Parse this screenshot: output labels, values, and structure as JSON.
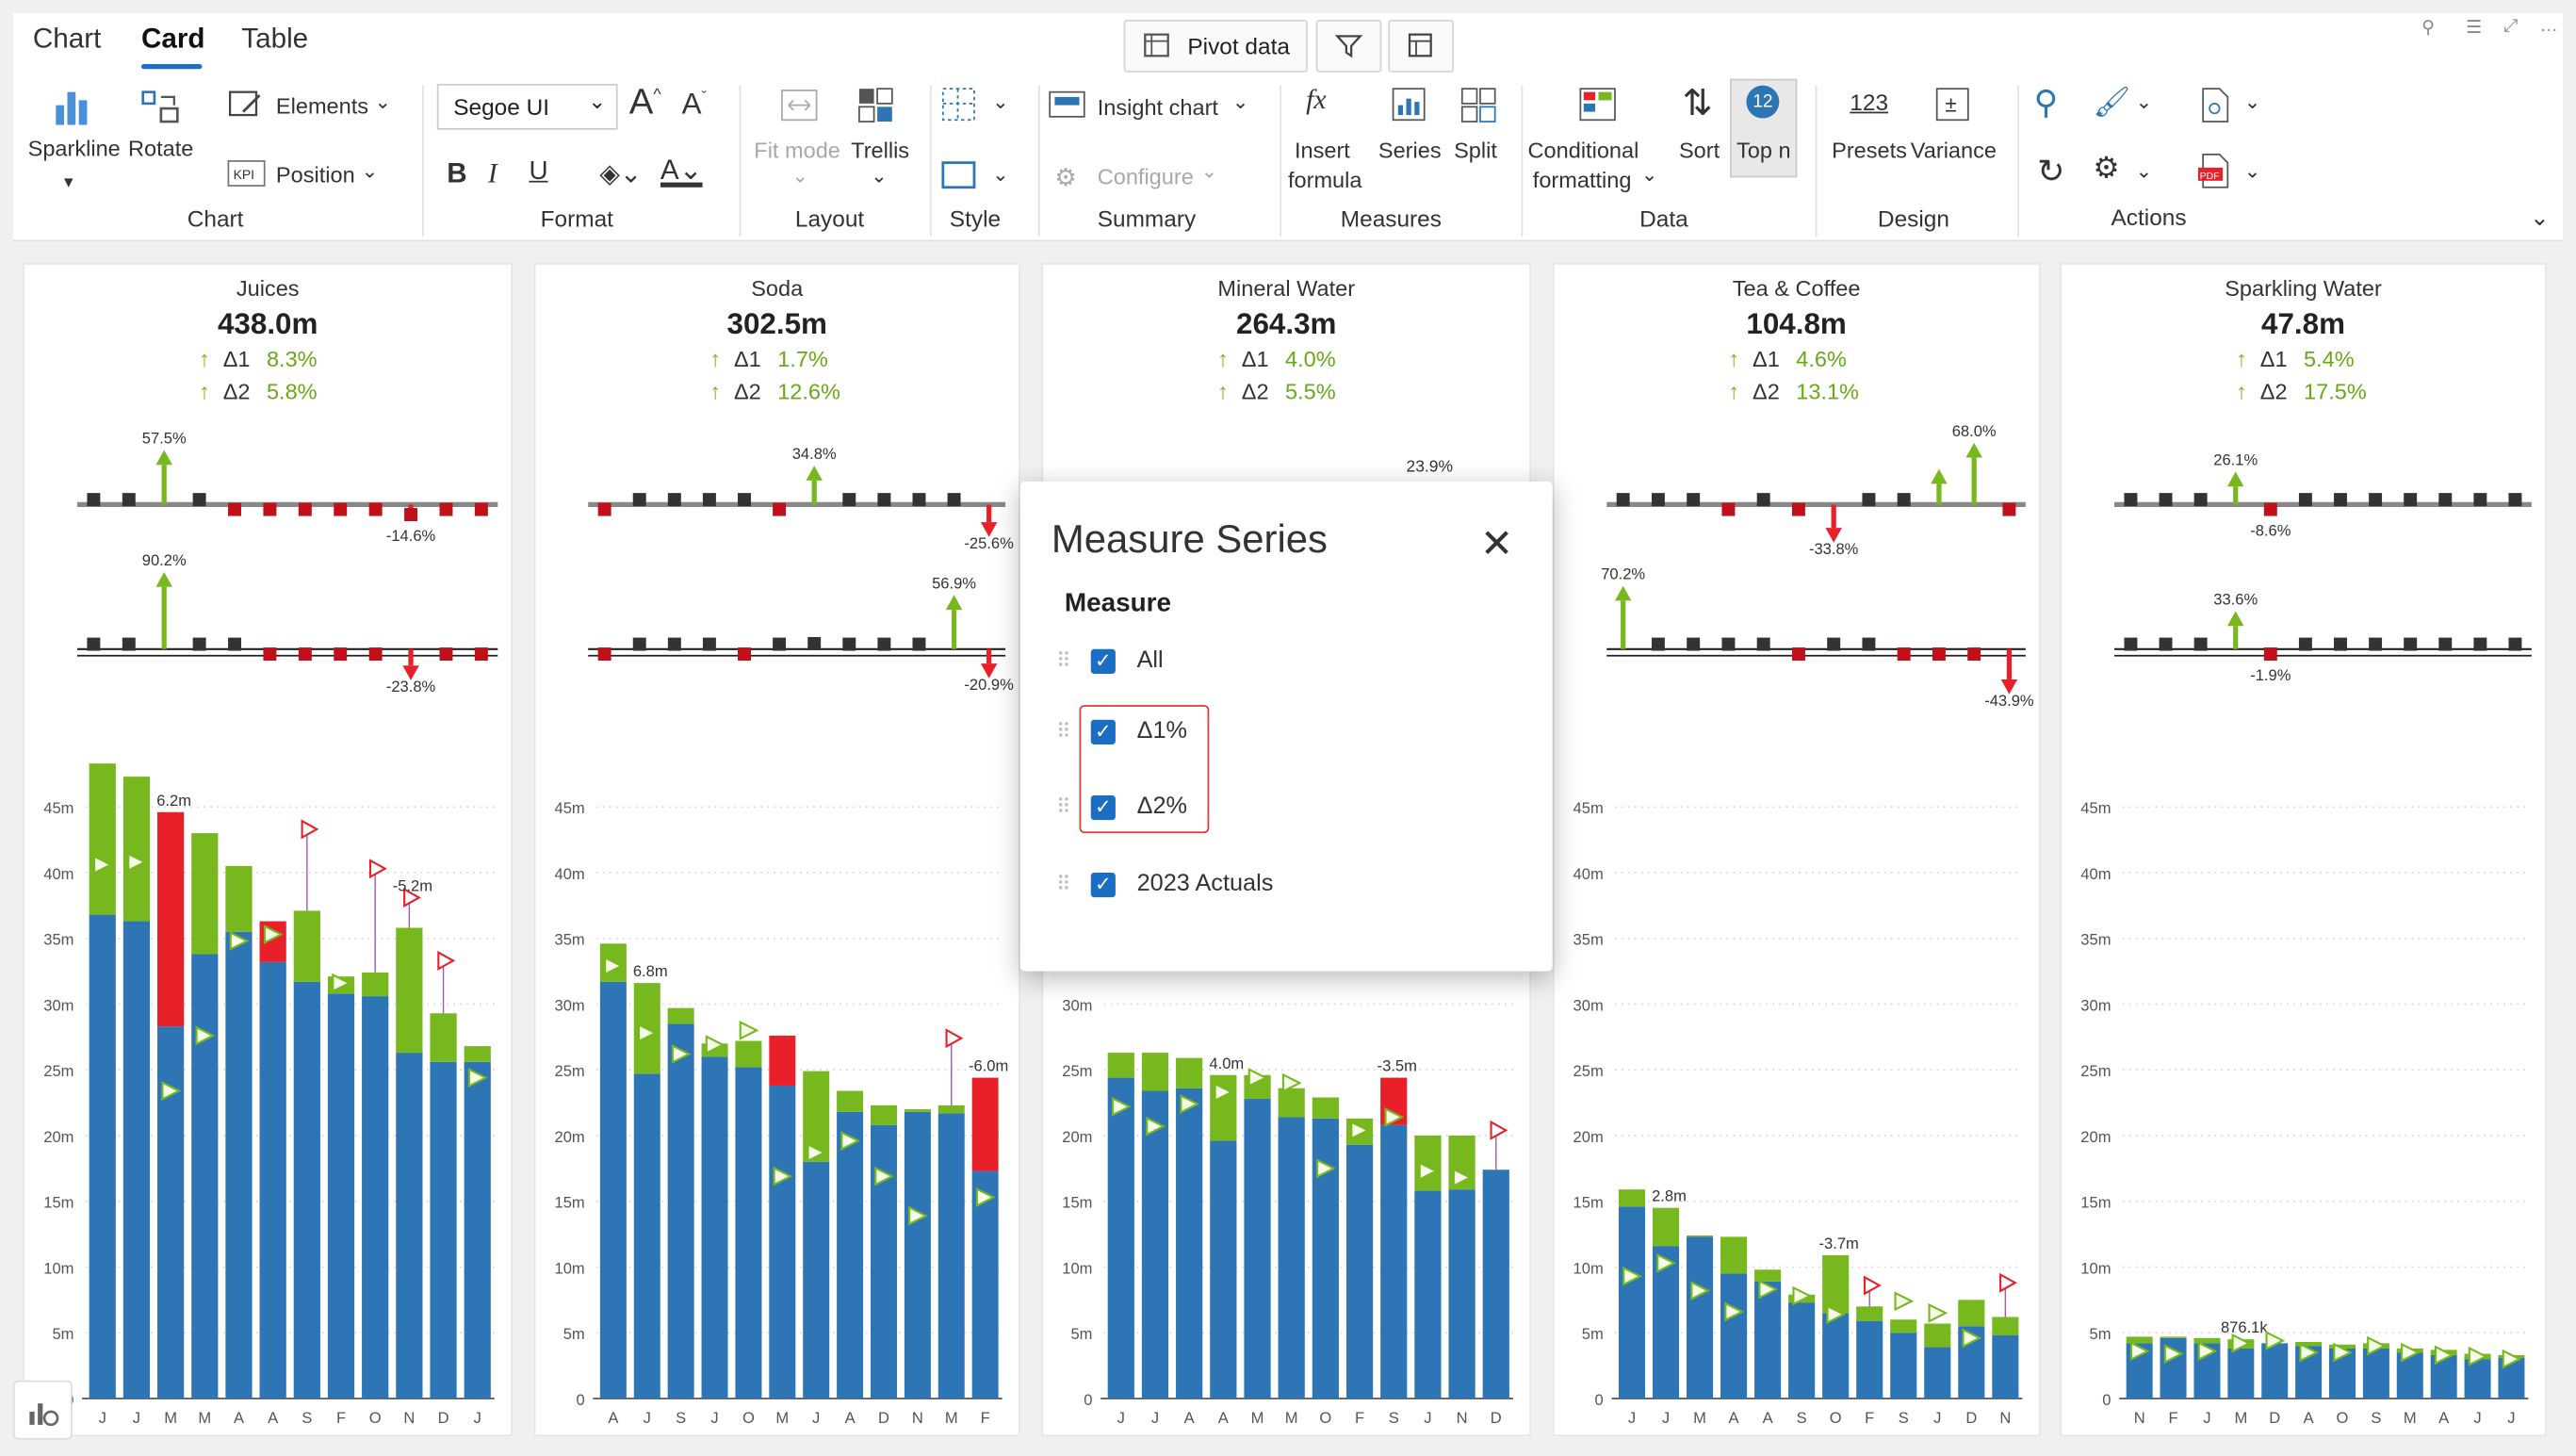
{
  "tabs": [
    "Chart",
    "Card",
    "Table"
  ],
  "active_tab": "Card",
  "top_buttons": {
    "pivot": "Pivot data"
  },
  "ribbon": {
    "chart_group": {
      "label": "Chart",
      "sparkline": "Sparkline",
      "rotate": "Rotate",
      "elements": "Elements",
      "position": "Position"
    },
    "format_group": {
      "label": "Format",
      "font": "Segoe UI"
    },
    "layout_group": {
      "label": "Layout",
      "fit_mode": "Fit mode",
      "trellis": "Trellis"
    },
    "style_group": {
      "label": "Style"
    },
    "summary_group": {
      "label": "Summary",
      "insight_chart": "Insight chart",
      "configure": "Configure"
    },
    "measures_group": {
      "label": "Measures",
      "insert_formula_1": "Insert",
      "insert_formula_2": "formula",
      "series": "Series",
      "split": "Split"
    },
    "data_group": {
      "label": "Data",
      "conditional_1": "Conditional",
      "conditional_2": "formatting",
      "sort": "Sort",
      "top_n": "Top n",
      "top_n_badge": "12"
    },
    "design_group": {
      "label": "Design",
      "presets": "Presets",
      "presets_icon": "123",
      "variance": "Variance"
    },
    "actions_group": {
      "label": "Actions"
    }
  },
  "cards": [
    {
      "title": "Juices",
      "value": "438.0m",
      "d1_label": "Δ1",
      "d1": "8.3%",
      "d2_label": "Δ2",
      "d2": "5.8%"
    },
    {
      "title": "Soda",
      "value": "302.5m",
      "d1_label": "Δ1",
      "d1": "1.7%",
      "d2_label": "Δ2",
      "d2": "12.6%"
    },
    {
      "title": "Mineral Water",
      "value": "264.3m",
      "d1_label": "Δ1",
      "d1": "4.0%",
      "d2_label": "Δ2",
      "d2": "5.5%"
    },
    {
      "title": "Tea & Coffee",
      "value": "104.8m",
      "d1_label": "Δ1",
      "d1": "4.6%",
      "d2_label": "Δ2",
      "d2": "13.1%"
    },
    {
      "title": "Sparkling Water",
      "value": "47.8m",
      "d1_label": "Δ1",
      "d1": "5.4%",
      "d2_label": "Δ2",
      "d2": "17.5%"
    }
  ],
  "chart_data": [
    {
      "type": "bar",
      "title": "Juices",
      "categories": [
        "J",
        "J",
        "M",
        "M",
        "A",
        "A",
        "S",
        "F",
        "O",
        "N",
        "D",
        "J"
      ],
      "ylim": [
        0,
        45
      ],
      "yticks": [
        "0",
        "5m",
        "10m",
        "15m",
        "20m",
        "25m",
        "30m",
        "35m",
        "40m",
        "45m"
      ],
      "series": [
        {
          "name": "2023 Actuals",
          "values": [
            36.8,
            36.3,
            28.3,
            33.8,
            35.5,
            33.2,
            31.7,
            30.8,
            30.6,
            26.3,
            25.6,
            25.6
          ]
        },
        {
          "values": [
            48.3,
            47.3,
            44.6,
            43.0,
            40.5,
            36.3,
            37.1,
            32.1,
            32.4,
            35.8,
            29.3,
            26.8
          ]
        },
        {
          "values": [
            40.6,
            40.8,
            23.4,
            27.6,
            34.8,
            35.3,
            43.3,
            31.6,
            40.3,
            38.1,
            33.3,
            24.4
          ]
        }
      ],
      "spark1": {
        "values": [
          3.5,
          5.0,
          57.5,
          3.0,
          -1.0,
          -1.5,
          -5.5,
          -2.0,
          -3.0,
          -14.6,
          -4.5,
          -3.0
        ],
        "labels": {
          "2": "57.5%",
          "9": "-14.6%"
        }
      },
      "spark2": {
        "values": [
          5.0,
          4.0,
          90.2,
          3.5,
          0.0,
          -5.0,
          -3.0,
          -2.0,
          -5.0,
          -23.8,
          -6.0,
          -2.0
        ],
        "labels": {
          "2": "90.2%",
          "9": "-23.8%"
        }
      },
      "labels": {
        "2": "6.2m",
        "9": "-5.2m"
      }
    },
    {
      "type": "bar",
      "title": "Soda",
      "categories": [
        "A",
        "J",
        "S",
        "J",
        "O",
        "M",
        "J",
        "A",
        "D",
        "N",
        "M",
        "F"
      ],
      "ylim": [
        0,
        45
      ],
      "yticks": [
        "0",
        "5m",
        "10m",
        "15m",
        "20m",
        "25m",
        "30m",
        "35m",
        "40m",
        "45m"
      ],
      "series": [
        {
          "name": "2023 Actuals",
          "values": [
            31.7,
            24.7,
            28.5,
            26.0,
            25.2,
            23.8,
            18.0,
            21.8,
            20.8,
            21.8,
            21.7,
            17.3
          ]
        },
        {
          "values": [
            34.6,
            31.6,
            29.7,
            27.0,
            27.2,
            27.6,
            24.9,
            23.4,
            22.3,
            22.0,
            22.3,
            24.4
          ]
        },
        {
          "values": [
            32.9,
            27.8,
            26.2,
            26.9,
            28.0,
            16.9,
            18.7,
            19.6,
            16.9,
            13.9,
            27.4,
            15.3
          ]
        }
      ],
      "spark1": {
        "values": [
          -4.0,
          6.5,
          3.0,
          5.0,
          2.5,
          -3.0,
          34.8,
          3.5,
          2.5,
          3.0,
          3.0,
          -25.6
        ],
        "labels": {
          "6": "34.8%",
          "11": "-25.6%"
        }
      },
      "spark2": {
        "values": [
          -3.0,
          1.5,
          3.0,
          2.0,
          -2.5,
          5.0,
          8.0,
          4.0,
          2.5,
          3.0,
          56.9,
          -20.9
        ],
        "labels": {
          "10": "56.9%",
          "11": "-20.9%"
        }
      },
      "labels": {
        "1": "6.8m",
        "11": "-6.0m"
      }
    },
    {
      "type": "bar",
      "title": "Mineral Water",
      "categories": [
        "J",
        "J",
        "A",
        "A",
        "M",
        "M",
        "O",
        "F",
        "S",
        "J",
        "N",
        "D"
      ],
      "ylim": [
        0,
        45
      ],
      "yticks": [
        "0",
        "5m",
        "10m",
        "15m",
        "20m",
        "25m",
        "30m",
        "35m",
        "40m",
        "45m"
      ],
      "series": [
        {
          "name": "2023 Actuals",
          "values": [
            24.4,
            23.4,
            23.6,
            19.6,
            22.8,
            21.4,
            21.3,
            19.3,
            20.8,
            15.8,
            15.9,
            17.4
          ]
        },
        {
          "values": [
            26.3,
            26.3,
            25.9,
            24.6,
            24.6,
            23.6,
            22.9,
            21.3,
            24.4,
            20.0,
            20.0,
            17.4
          ]
        },
        {
          "values": [
            22.2,
            20.7,
            22.4,
            23.3,
            24.4,
            24.0,
            17.5,
            20.4,
            21.4,
            17.3,
            16.8,
            20.4
          ]
        }
      ],
      "spark1": {
        "values": [],
        "labels": {}
      },
      "spark2": {
        "values": [],
        "labels": {}
      },
      "labels": {
        "3": "4.0m",
        "8": "-3.5m"
      }
    },
    {
      "type": "bar",
      "title": "Tea & Coffee",
      "categories": [
        "J",
        "J",
        "M",
        "A",
        "A",
        "S",
        "O",
        "F",
        "S",
        "J",
        "D",
        "N"
      ],
      "ylim": [
        0,
        45
      ],
      "yticks": [
        "0",
        "5m",
        "10m",
        "15m",
        "20m",
        "25m",
        "30m",
        "35m",
        "40m",
        "45m"
      ],
      "series": [
        {
          "name": "2023 Actuals",
          "values": [
            14.6,
            11.6,
            12.3,
            9.5,
            8.9,
            7.3,
            6.5,
            5.9,
            5.0,
            3.9,
            5.5,
            4.8
          ]
        },
        {
          "values": [
            15.9,
            14.5,
            12.4,
            12.3,
            9.8,
            7.9,
            10.9,
            7.0,
            6.0,
            5.7,
            7.5,
            6.2
          ]
        },
        {
          "values": [
            9.3,
            10.3,
            8.2,
            6.6,
            8.3,
            7.8,
            6.4,
            8.6,
            7.4,
            6.5,
            4.6,
            8.8
          ]
        }
      ],
      "spark1": {
        "values": [
          2.5,
          4.0,
          2.5,
          -5.0,
          2.0,
          -3.5,
          -33.8,
          3.0,
          2.5,
          30.0,
          68.0,
          -6.0
        ],
        "labels": {
          "6": "-33.8%",
          "10": "68.0%"
        }
      },
      "spark2": {
        "values": [
          70.2,
          5.0,
          4.0,
          3.5,
          2.0,
          -2.0,
          3.0,
          2.0,
          -6.0,
          -3.0,
          -3.5,
          -43.9
        ],
        "labels": {
          "0": "70.2%",
          "11": "-43.9%"
        }
      },
      "labels": {
        "1": "2.8m",
        "6": "-3.7m"
      }
    },
    {
      "type": "bar",
      "title": "Sparkling Water",
      "categories": [
        "N",
        "F",
        "J",
        "M",
        "D",
        "A",
        "O",
        "S",
        "M",
        "A",
        "J",
        "J"
      ],
      "ylim": [
        0,
        45
      ],
      "yticks": [
        "0",
        "5m",
        "10m",
        "15m",
        "20m",
        "25m",
        "30m",
        "35m",
        "40m",
        "45m"
      ],
      "series": [
        {
          "name": "2023 Actuals",
          "values": [
            4.2,
            4.6,
            4.2,
            3.8,
            4.2,
            4.0,
            3.8,
            3.8,
            3.5,
            3.3,
            3.0,
            3.1
          ]
        },
        {
          "values": [
            4.7,
            4.7,
            4.6,
            4.5,
            4.2,
            4.3,
            4.1,
            4.2,
            3.8,
            3.7,
            3.4,
            3.3
          ]
        },
        {
          "values": [
            3.6,
            3.4,
            3.6,
            4.2,
            4.4,
            3.5,
            3.5,
            4.0,
            3.5,
            3.3,
            3.2,
            3.0
          ]
        }
      ],
      "spark1": {
        "values": [
          6.0,
          3.0,
          2.5,
          26.1,
          -4.0,
          2.5,
          2.0,
          2.0,
          2.5,
          4.0,
          3.0,
          5.0
        ],
        "labels": {
          "3": "26.1%",
          "4": "-8.6%"
        }
      },
      "spark2": {
        "values": [
          4.0,
          3.0,
          3.0,
          33.6,
          -1.9,
          3.0,
          2.5,
          3.0,
          3.5,
          3.0,
          2.5,
          3.0
        ],
        "labels": {
          "3": "33.6%",
          "4": "-1.9%"
        }
      },
      "labels": {
        "3": "876.1k"
      }
    }
  ],
  "extra_label": "23.9%",
  "dialog": {
    "title": "Measure Series",
    "subtitle": "Measure",
    "items": [
      "All",
      "Δ1%",
      "Δ2%",
      "2023 Actuals"
    ]
  },
  "colors": {
    "actual": "#2e75b6",
    "positive": "#77b81f",
    "negative": "#e8202a",
    "accent": "#1a6fc4"
  }
}
